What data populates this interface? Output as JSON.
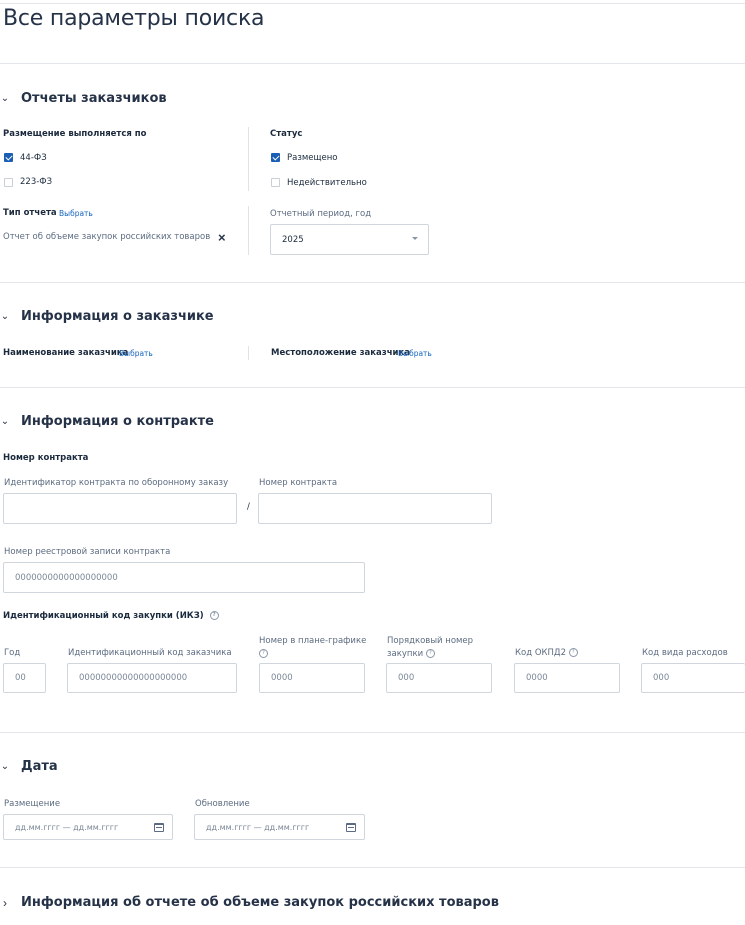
{
  "page_title": "Все параметры поиска",
  "sections": {
    "customer_reports": {
      "title": "Отчеты заказчиков",
      "placement_label": "Размещение выполняется по",
      "placement_options": [
        {
          "label": "44-ФЗ",
          "checked": true
        },
        {
          "label": "223-ФЗ",
          "checked": false
        }
      ],
      "status_label": "Статус",
      "status_options": [
        {
          "label": "Размещено",
          "checked": true
        },
        {
          "label": "Недействительно",
          "checked": false
        }
      ],
      "report_type_label": "Тип отчета",
      "report_type_link": "Выбрать",
      "report_type_value": "Отчет об объеме закупок российских товаров",
      "remove_icon": "×",
      "period_label": "Отчетный период, год",
      "period_value": "2025"
    },
    "customer_info": {
      "title": "Информация о заказчике",
      "name_label": "Наименование заказчика",
      "name_link": "Выбрать",
      "location_label": "Местоположение заказчика",
      "location_link": "Выбрать"
    },
    "contract_info": {
      "title": "Информация о контракте",
      "contract_number_label": "Номер контракта",
      "defense_id_label": "Идентификатор контракта по оборонному заказу",
      "separator": "/",
      "contract_number_field_label": "Номер контракта",
      "registry_label": "Номер реестровой записи контракта",
      "registry_placeholder": "0000000000000000000",
      "ikz_label": "Идентификационный код закупки (ИКЗ)",
      "help_glyph": "?",
      "ikz_fields": [
        {
          "label": "Год",
          "placeholder": "00"
        },
        {
          "label": "Идентификационный код заказчика",
          "placeholder": "00000000000000000000"
        },
        {
          "label_line1": "Номер в плане-графике",
          "placeholder": "0000"
        },
        {
          "label_line1": "Порядковый номер",
          "label_line2": "закупки",
          "placeholder": "000"
        },
        {
          "label": "Код ОКПД2",
          "placeholder": "0000"
        },
        {
          "label": "Код вида расходов",
          "placeholder": "000"
        }
      ]
    },
    "date": {
      "title": "Дата",
      "placement_label": "Размещение",
      "placement_placeholder": "дд.мм.гггг — дд.мм.гггг",
      "update_label": "Обновление",
      "update_placeholder": "дд.мм.гггг — дд.мм.гггг"
    },
    "report_info": {
      "title": "Информация об отчете об объеме закупок российских товаров"
    }
  },
  "colors": {
    "accent": "#1a5fb4",
    "link": "#1565c0",
    "text": "#1b2a3d",
    "muted": "#5c6b80",
    "border": "#cfd6de"
  }
}
